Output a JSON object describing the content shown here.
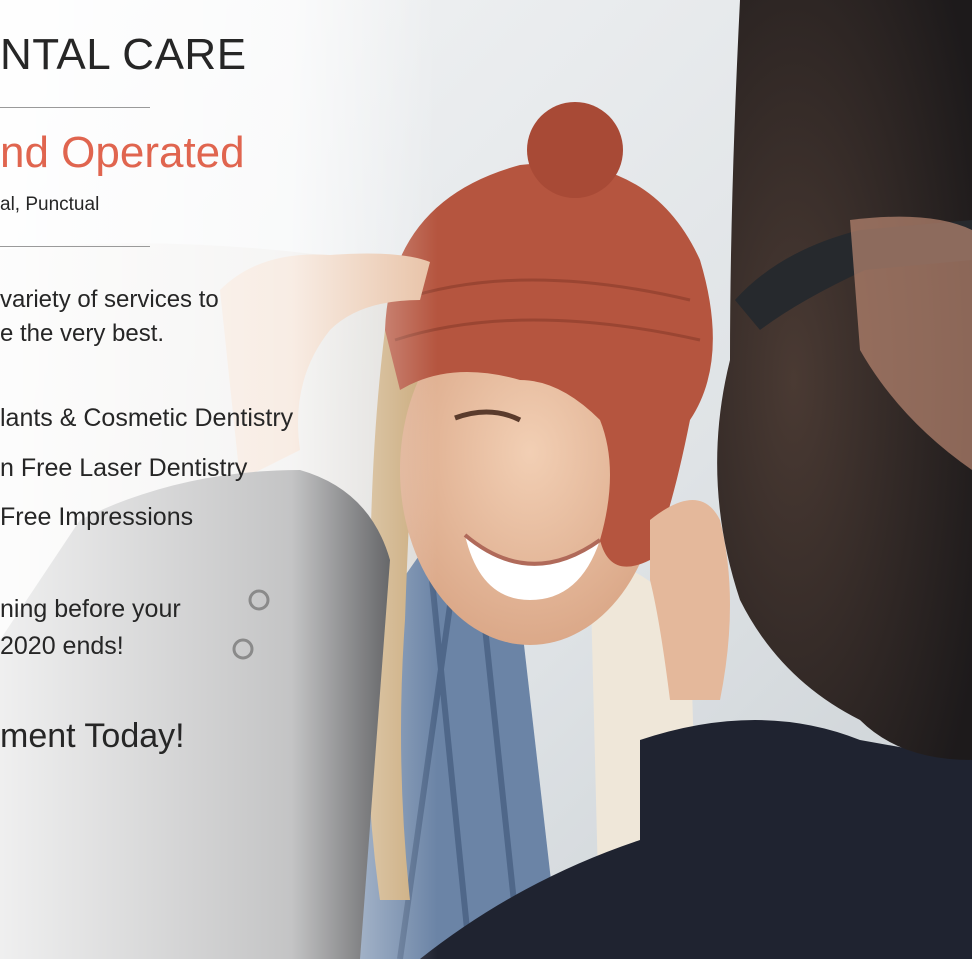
{
  "ad": {
    "brand": "NTAL CARE",
    "headline": "nd Operated",
    "subheadline": "al, Punctual",
    "intro_line1": "variety of services to",
    "intro_line2": "e the very best.",
    "services": [
      "lants & Cosmetic Dentistry",
      "n Free Laser Dentistry",
      "Free Impressions"
    ],
    "promo_line1": "ning before your",
    "promo_line2": "2020 ends!",
    "cta": "ment Today!"
  },
  "colors": {
    "accent": "#e0654f",
    "text": "#262626",
    "hat": "#b5553f"
  }
}
